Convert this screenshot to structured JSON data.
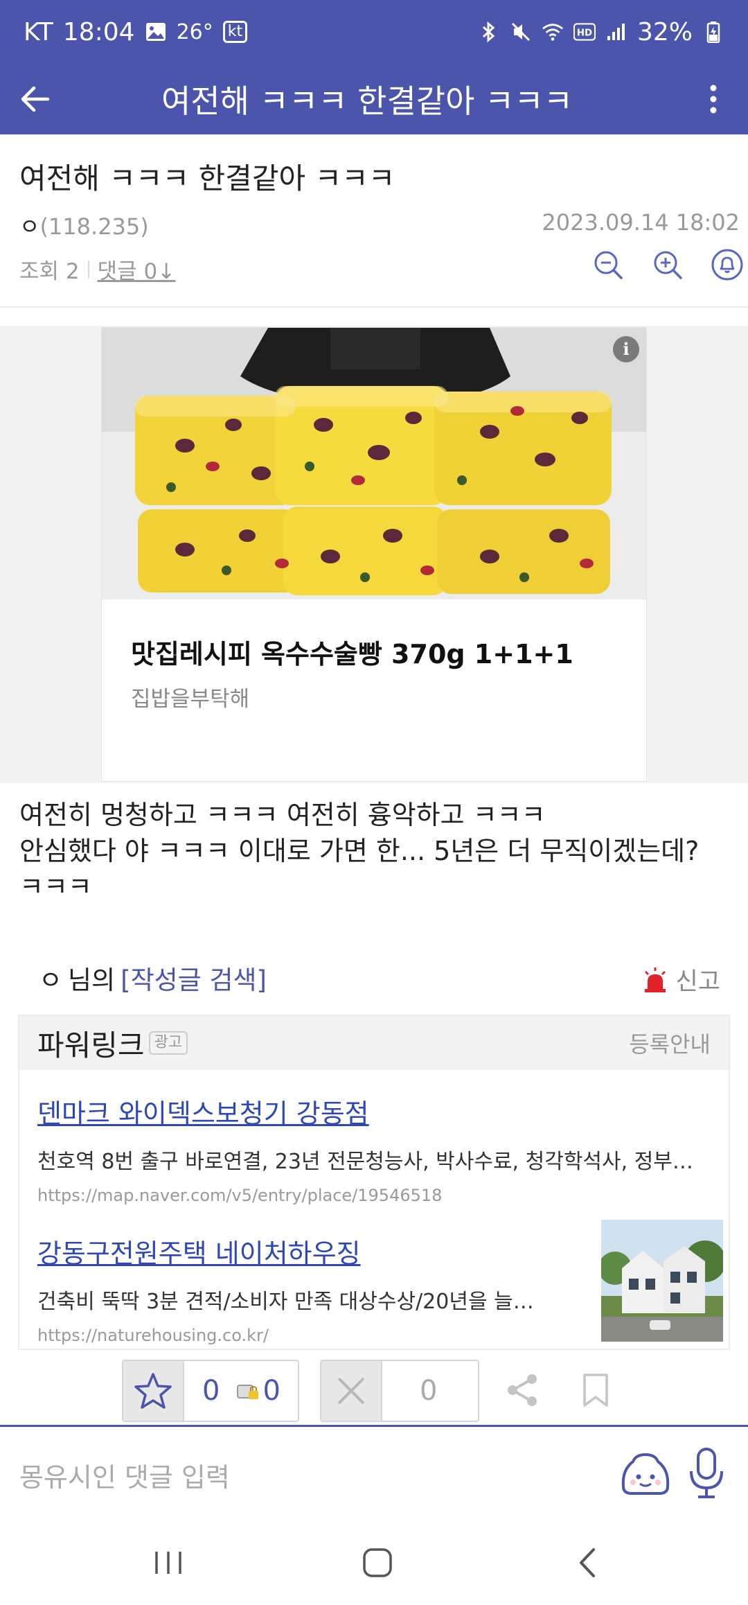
{
  "status_bar": {
    "carrier": "KT",
    "time": "18:04",
    "temperature": "26°",
    "carrier_badge": "kt",
    "battery": "32%"
  },
  "app_bar": {
    "title": "여전해 ㅋㅋㅋ 한결같아 ㅋㅋㅋ"
  },
  "post": {
    "title": "여전해 ㅋㅋㅋ 한결같아 ㅋㅋㅋ",
    "author_nick": "ㅇ",
    "author_ip": "(118.235)",
    "date": "2023.09.14 18:02",
    "views": "조회 2",
    "comments": "댓글 0↓",
    "body_lines": [
      "여전히 멍청하고 ㅋㅋㅋ 여전히 흉악하고 ㅋㅋㅋ",
      "안심했다 야 ㅋㅋㅋ 이대로 가면 한... 5년은 더 무직이겠는데?",
      "ㅋㅋㅋ"
    ]
  },
  "ad": {
    "info_badge": "i",
    "product_name": "맛집레시피 옥수수술빵 370g 1+1+1",
    "shop_name": "집밥을부탁해"
  },
  "author_search": {
    "nick": "ㅇ",
    "suffix": "님의",
    "link": "[작성글 검색]",
    "report": "신고"
  },
  "powerlink": {
    "title": "파워링크",
    "badge": "광고",
    "register": "등록안내",
    "items": [
      {
        "title": "덴마크 와이덱스보청기 강동점",
        "desc": "천호역 8번 출구 바로연결, 23년 전문청능사, 박사수료, 청각학석사, 정부…",
        "url": "https://map.naver.com/v5/entry/place/19546518"
      },
      {
        "title": "강동구전원주택 네이처하우징",
        "desc": "건축비 뚝딱 3분 견적/소비자 만족 대상수상/20년을 늘…",
        "url": "https://naturehousing.co.kr/"
      }
    ]
  },
  "actions": {
    "recommend_count": "0",
    "fixed_recommend_count": "0",
    "not_recommend_count": "0"
  },
  "comment_input": {
    "placeholder": "몽유시인 댓글 입력"
  },
  "colors": {
    "brand": "#4a55ab",
    "link": "#2e46b8",
    "report_red": "#e0242a"
  }
}
